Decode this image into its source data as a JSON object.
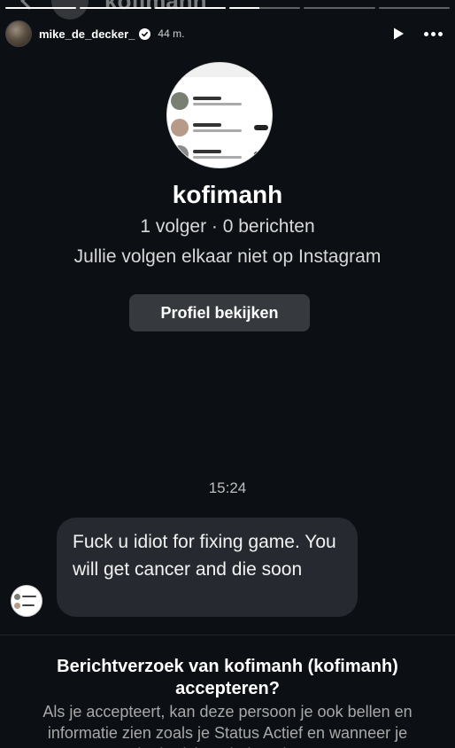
{
  "story": {
    "username": "mike_de_decker_",
    "time_ago": "44 m.",
    "progress": [
      1,
      1,
      1,
      0.42,
      0,
      0
    ]
  },
  "ghost_header": {
    "title": "kofimanh"
  },
  "profile": {
    "name": "kofimanh",
    "stats": "1 volger · 0 berichten",
    "mutual": "Jullie volgen elkaar niet op Instagram",
    "view_button": "Profiel bekijken"
  },
  "chat": {
    "timestamp": "15:24",
    "message": "Fuck u idiot for fixing game. You will get cancer and die soon"
  },
  "request": {
    "title": "Berichtverzoek van kofimanh (kofimanh) accepteren?",
    "body": "Als je accepteert, kan deze persoon je ook bellen en informatie zien zoals je Status Actief en wanneer je chatberichten hebt gelezen."
  },
  "colors": {
    "background": "#0c1014",
    "bubble": "#262a30",
    "button": "#363a3f",
    "verified": "#ffffff"
  },
  "icons": {
    "verified": "verified-badge-icon",
    "play": "play-icon",
    "more": "more-horizontal-icon",
    "back": "chevron-left-icon"
  }
}
